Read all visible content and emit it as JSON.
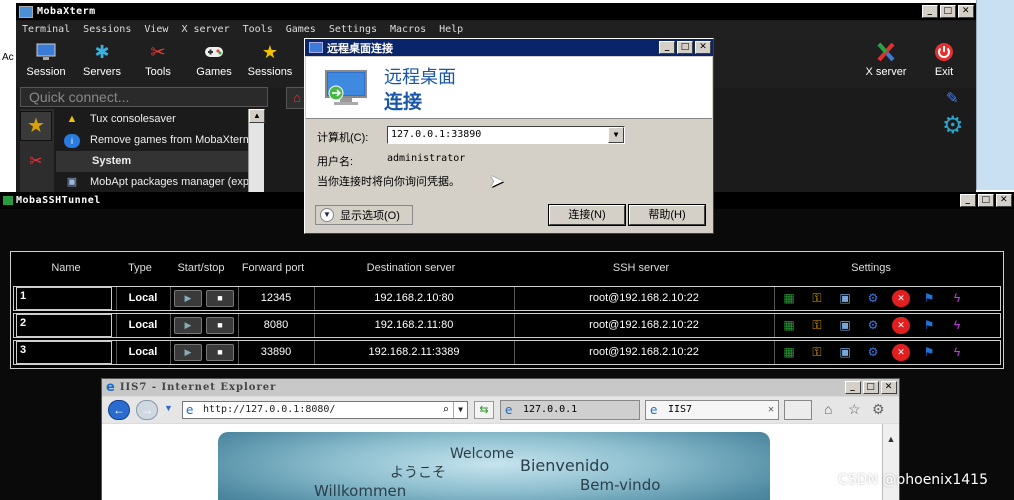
{
  "desktop": {
    "left_text": "Ac"
  },
  "moba": {
    "title": "MobaXterm",
    "menu": [
      "Terminal",
      "Sessions",
      "View",
      "X server",
      "Tools",
      "Games",
      "Settings",
      "Macros",
      "Help"
    ],
    "toolbar": {
      "session": "Session",
      "servers": "Servers",
      "tools": "Tools",
      "games": "Games",
      "sessions": "Sessions",
      "xserver": "X server",
      "exit": "Exit"
    },
    "quick_connect_placeholder": "Quick connect...",
    "tools_list": {
      "item1": "Tux consolesaver",
      "item2": "Remove games from MobaXterm",
      "section": "System",
      "item3": "MobApt packages manager (expe"
    }
  },
  "rdp": {
    "title": "远程桌面连接",
    "heading_line1": "远程桌面",
    "heading_line2": "连接",
    "computer_label": "计算机(C):",
    "computer_value": "127.0.0.1:33890",
    "user_label": "用户名:",
    "user_value": "administrator",
    "note": "当你连接时将向你询问凭据。",
    "options_label": "显示选项(O)",
    "connect_label": "连接(N)",
    "help_label": "帮助(H)"
  },
  "tunnel": {
    "title": "MobaSSHTunnel",
    "columns": {
      "name": "Name",
      "type": "Type",
      "startstop": "Start/stop",
      "forward_port": "Forward port",
      "destination": "Destination server",
      "ssh": "SSH server",
      "settings": "Settings"
    },
    "rows": [
      {
        "name": "1",
        "type": "Local",
        "forward_port": "12345",
        "destination": "192.168.2.10:80",
        "ssh": "root@192.168.2.10:22"
      },
      {
        "name": "2",
        "type": "Local",
        "forward_port": "8080",
        "destination": "192.168.2.11:80",
        "ssh": "root@192.168.2.10:22"
      },
      {
        "name": "3",
        "type": "Local",
        "forward_port": "33890",
        "destination": "192.168.2.11:3389",
        "ssh": "root@192.168.2.10:22"
      }
    ]
  },
  "ie": {
    "title": "IIS7 - Internet Explorer",
    "address": "http://127.0.0.1:8080/",
    "tab1": "127.0.0.1",
    "tab2": "IIS7",
    "welcome_words": {
      "welcome": "Welcome",
      "japanese": "ようこそ",
      "spanish": "Bienvenido",
      "portuguese": "Bem-vindo",
      "german": "Willkommen"
    }
  },
  "watermark": "CSDN @phoenix1415",
  "colors": {
    "rdp_title_bar": "#0a246a",
    "rdp_heading": "#1a56a8",
    "moba_background": "#1b1b1b",
    "classic_face": "#d4d0c8"
  },
  "icons": {
    "toolbar": [
      "monitor-icon",
      "servers-icon",
      "tools-icon",
      "gamepad-icon",
      "star-icon",
      "xserver-icon",
      "power-icon"
    ],
    "tunnel_settings": [
      "network-icon",
      "key-icon",
      "screen-icon",
      "gears-icon",
      "delete-icon",
      "runner-icon",
      "lightning-icon"
    ]
  }
}
